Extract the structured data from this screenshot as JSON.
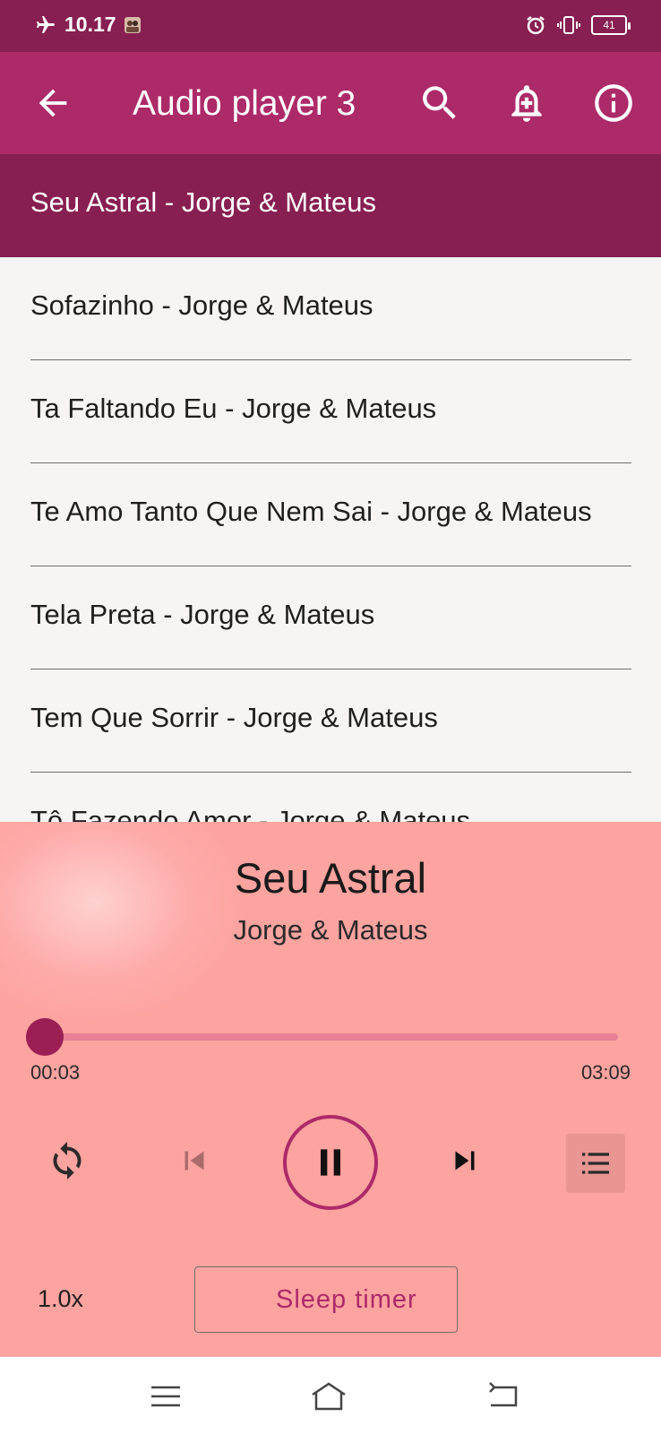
{
  "status_bar": {
    "time": "10.17",
    "battery": "41"
  },
  "app_bar": {
    "title": "Audio player 3"
  },
  "playlist": [
    {
      "label": "Seu Astral - Jorge & Mateus",
      "active": true
    },
    {
      "label": "Sofazinho - Jorge & Mateus",
      "active": false
    },
    {
      "label": "Ta Faltando Eu - Jorge & Mateus",
      "active": false
    },
    {
      "label": "Te Amo Tanto Que Nem Sai - Jorge & Mateus",
      "active": false
    },
    {
      "label": "Tela Preta - Jorge & Mateus",
      "active": false
    },
    {
      "label": "Tem Que Sorrir - Jorge & Mateus",
      "active": false
    },
    {
      "label": "Tô Fazendo Amor - Jorge & Mateus",
      "active": false
    }
  ],
  "player": {
    "title": "Seu Astral",
    "artist": "Jorge & Mateus",
    "elapsed": "00:03",
    "total": "03:09",
    "progress_fraction": 0.016,
    "speed": "1.0x",
    "sleep_timer_label": "Sleep timer"
  },
  "colors": {
    "status_bar": "#871f52",
    "app_bar": "#ad2a69",
    "active_row": "#871f52",
    "player_bg": "#fda3a0",
    "accent": "#ad2a69"
  },
  "icons": {
    "back": "arrow-left-icon",
    "search": "search-icon",
    "add_alarm": "bell-plus-icon",
    "info": "info-icon",
    "repeat": "repeat-icon",
    "previous": "skip-previous-icon",
    "pause": "pause-icon",
    "next": "skip-next-icon",
    "queue": "queue-list-icon",
    "sleep": "moon-icon"
  }
}
